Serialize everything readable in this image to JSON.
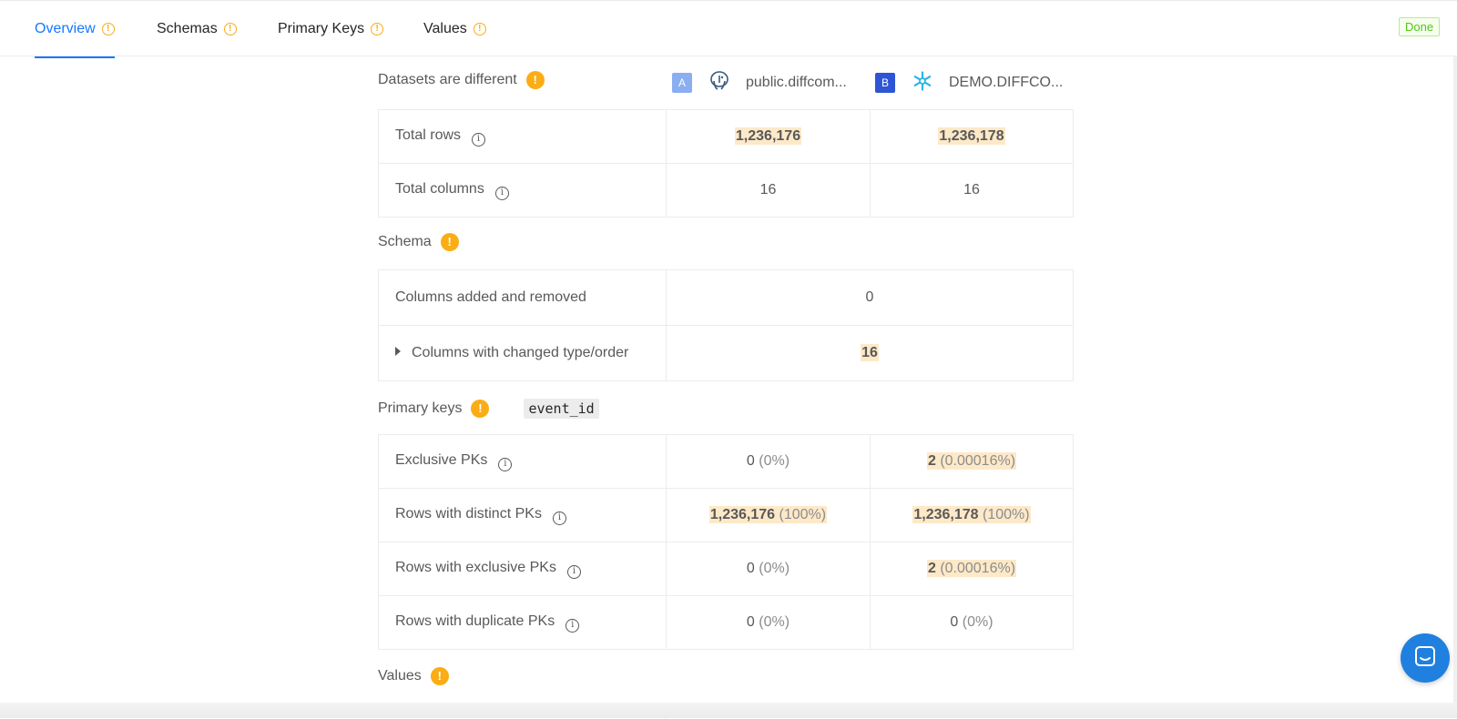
{
  "tabs": [
    {
      "label": "Overview",
      "active": true
    },
    {
      "label": "Schemas"
    },
    {
      "label": "Primary Keys"
    },
    {
      "label": "Values"
    }
  ],
  "status": "Done",
  "datasets": {
    "title": "Datasets are different",
    "a": {
      "badge": "A",
      "db_icon": "postgres-icon",
      "name": "public.diffcom..."
    },
    "b": {
      "badge": "B",
      "db_icon": "snowflake-icon",
      "name": "DEMO.DIFFCO..."
    }
  },
  "overview_rows": [
    {
      "label": "Total rows",
      "a": "1,236,176",
      "b": "1,236,178",
      "highlight": true
    },
    {
      "label": "Total columns",
      "a": "16",
      "b": "16",
      "highlight": false
    }
  ],
  "schema": {
    "title": "Schema",
    "rows": [
      {
        "label": "Columns added and removed",
        "value": "0"
      },
      {
        "label": "Columns with changed type/order",
        "value": "16"
      }
    ]
  },
  "primary_keys": {
    "title": "Primary keys",
    "key": "event_id",
    "rows": [
      {
        "label": "Exclusive PKs",
        "a_num": "0",
        "a_pct": "(0%)",
        "b_num": "2",
        "b_pct": "(0.00016%)"
      },
      {
        "label": "Rows with distinct PKs",
        "a_num": "1,236,176",
        "a_pct": "(100%)",
        "b_num": "1,236,178",
        "b_pct": "(100%)"
      },
      {
        "label": "Rows with exclusive PKs",
        "a_num": "0",
        "a_pct": "(0%)",
        "b_num": "2",
        "b_pct": "(0.00016%)"
      },
      {
        "label": "Rows with duplicate PKs",
        "a_num": "0",
        "a_pct": "(0%)",
        "b_num": "0",
        "b_pct": "(0%)"
      }
    ]
  },
  "values": {
    "title": "Values"
  },
  "colors": {
    "accent": "#1677ff",
    "warning": "#faad14",
    "highlight": "#fde9c8",
    "success": "#52c41a"
  }
}
